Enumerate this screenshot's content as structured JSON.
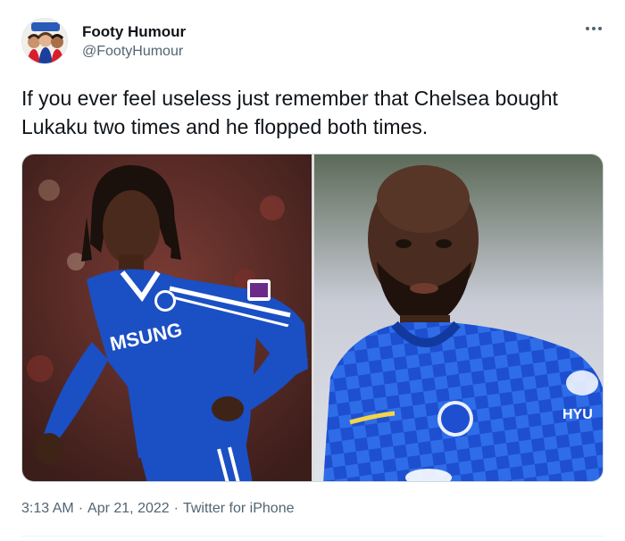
{
  "author": {
    "display_name": "Footy Humour",
    "handle": "@FootyHumour"
  },
  "tweet": {
    "text": "If you ever feel useless just remember that Chelsea bought Lukaku two times and he flopped both times."
  },
  "media": {
    "left_photo": {
      "shirt_text": "MSUNG"
    },
    "right_photo": {
      "shirt_text": "HYU"
    }
  },
  "meta": {
    "time": "3:13 AM",
    "separator": "·",
    "date": "Apr 21, 2022",
    "source": "Twitter for iPhone"
  },
  "colors": {
    "text_primary": "#0f1419",
    "text_secondary": "#536471",
    "chelsea_blue": "#1b4fc4"
  },
  "icons": {
    "more": "more-horizontal-icon"
  }
}
